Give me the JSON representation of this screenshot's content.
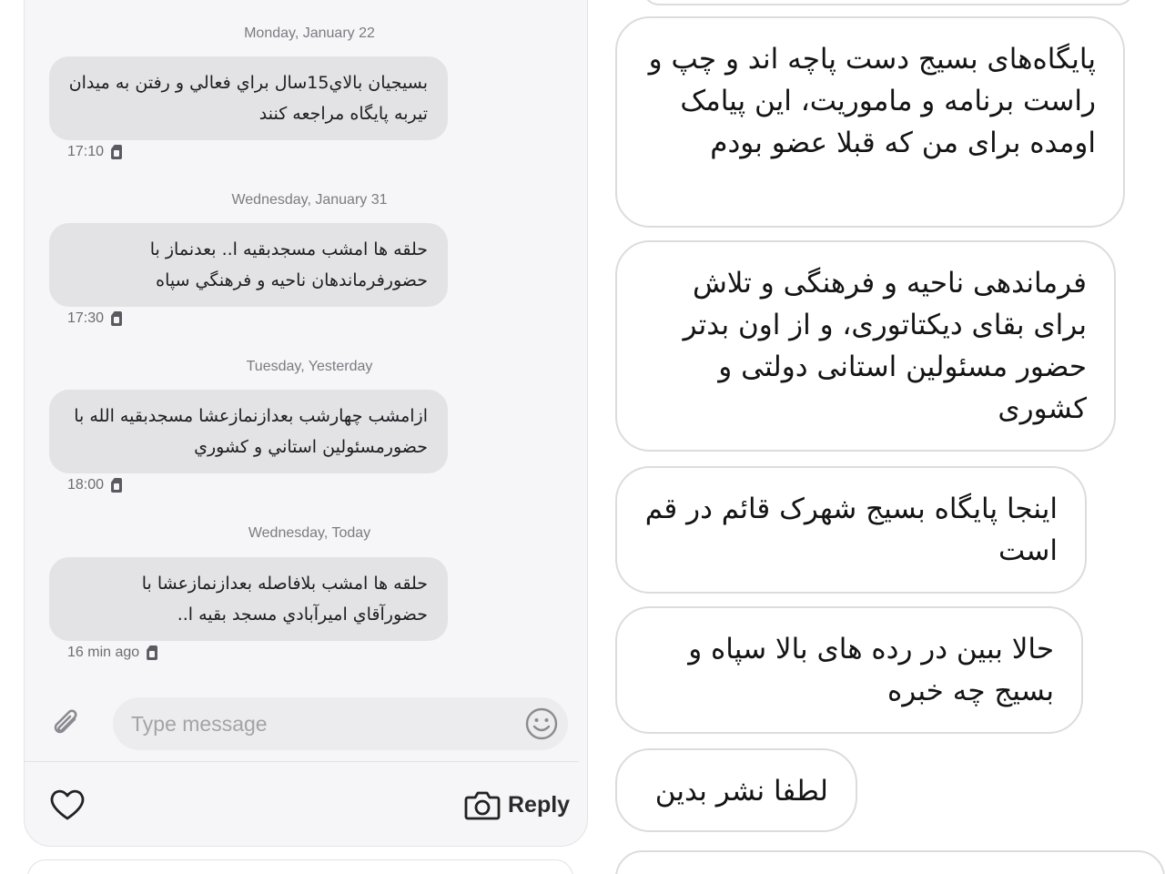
{
  "sms_thread": {
    "messages": [
      {
        "date": "Monday, January 22",
        "text": "بسيجيان بالاي15سال براي فعالي و رفتن به ميدان تيربه پايگاه مراجعه كنند",
        "time": "17:10"
      },
      {
        "date": "Wednesday, January 31",
        "text": "حلقه ها امشب مسجدبقيه ا.. بعدنماز با حضورفرماندهان ناحيه و فرهنگي سپاه",
        "time": "17:30"
      },
      {
        "date": "Tuesday, Yesterday",
        "text": "ازامشب چهارشب بعدازنمازعشا مسجدبقيه الله با حضورمسئولين استاني و كشوري",
        "time": "18:00"
      },
      {
        "date": "Wednesday, Today",
        "text": "حلقه ها امشب بلافاصله بعدازنمازعشا با حضورآقاي اميرآبادي مسجد بقيه ا..",
        "time": "16 min ago"
      }
    ],
    "composer": {
      "placeholder": "Type message"
    },
    "actions": {
      "reply_label": "Reply"
    }
  },
  "dm_thread": {
    "messages": [
      {
        "text": "پایگاه‌های بسیج دست پاچه اند و چپ و راست برنامه و ماموریت، این پیامک اومده برای من که قبلا عضو بودم"
      },
      {
        "text": "فرماندهی ناحیه و فرهنگی و تلاش برای بقای دیکتاتوری، و از اون بدتر حضور مسئولین استانی دولتی و کشوری"
      },
      {
        "text": "اینجا پایگاه بسیج شهرک قائم در قم است"
      },
      {
        "text": "حالا ببین در رده های بالا سپاه و بسیج چه خبره"
      },
      {
        "text": "لطفا نشر بدین"
      }
    ]
  },
  "icons": {
    "sim": "sim-card-icon",
    "attach": "paperclip-icon",
    "emoji": "emoji-icon",
    "heart": "heart-icon",
    "camera": "camera-icon"
  }
}
